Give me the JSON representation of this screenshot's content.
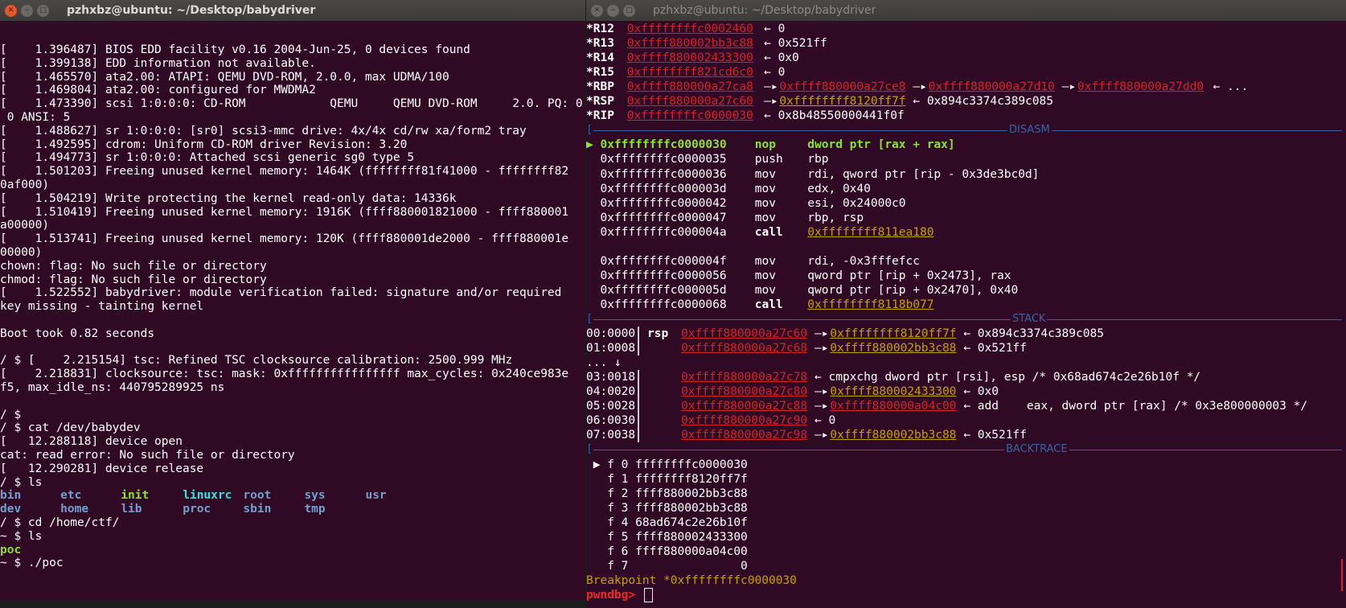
{
  "left": {
    "title": "pzhxbz@ubuntu: ~/Desktop/babydriver",
    "lines": [
      "[    1.396487] BIOS EDD facility v0.16 2004-Jun-25, 0 devices found",
      "[    1.399138] EDD information not available.",
      "[    1.465570] ata2.00: ATAPI: QEMU DVD-ROM, 2.0.0, max UDMA/100",
      "[    1.469804] ata2.00: configured for MWDMA2",
      "[    1.473390] scsi 1:0:0:0: CD-ROM            QEMU     QEMU DVD-ROM     2.0. PQ: 0",
      " 0 ANSI: 5",
      "[    1.488627] sr 1:0:0:0: [sr0] scsi3-mmc drive: 4x/4x cd/rw xa/form2 tray",
      "[    1.492595] cdrom: Uniform CD-ROM driver Revision: 3.20",
      "[    1.494773] sr 1:0:0:0: Attached scsi generic sg0 type 5",
      "[    1.501203] Freeing unused kernel memory: 1464K (ffffffff81f41000 - ffffffff82",
      "0af000)",
      "[    1.504219] Write protecting the kernel read-only data: 14336k",
      "[    1.510419] Freeing unused kernel memory: 1916K (ffff880001821000 - ffff880001",
      "a00000)",
      "[    1.513741] Freeing unused kernel memory: 120K (ffff880001de2000 - ffff880001e",
      "00000)",
      "chown: flag: No such file or directory",
      "chmod: flag: No such file or directory",
      "[    1.522552] babydriver: module verification failed: signature and/or required",
      "key missing - tainting kernel",
      "",
      "Boot took 0.82 seconds",
      "",
      "/ $ [    2.215154] tsc: Refined TSC clocksource calibration: 2500.999 MHz",
      "[    2.218831] clocksource: tsc: mask: 0xffffffffffffffff max_cycles: 0x240ce983e",
      "f5, max_idle_ns: 440795289925 ns",
      "",
      "/ $",
      "/ $ cat /dev/babydev",
      "[   12.288118] device open",
      "cat: read error: No such file or directory",
      "[   12.290281] device release",
      "/ $ ls"
    ],
    "ls1": [
      {
        "name": "bin",
        "c": "blu"
      },
      {
        "name": "etc",
        "c": "blu"
      },
      {
        "name": "init",
        "c": "grn"
      },
      {
        "name": "linuxrc",
        "c": "cyn"
      },
      {
        "name": "root",
        "c": "blu"
      },
      {
        "name": "sys",
        "c": "blu"
      },
      {
        "name": "usr",
        "c": "blu"
      }
    ],
    "ls2": [
      {
        "name": "dev",
        "c": "blu"
      },
      {
        "name": "home",
        "c": "blu"
      },
      {
        "name": "lib",
        "c": "blu"
      },
      {
        "name": "proc",
        "c": "blu"
      },
      {
        "name": "sbin",
        "c": "blu"
      },
      {
        "name": "tmp",
        "c": "blu"
      }
    ],
    "after": [
      "/ $ cd /home/ctf/",
      "~ $ ls"
    ],
    "poc": "poc",
    "last": "~ $ ./poc"
  },
  "right": {
    "title": "pzhxbz@ubuntu: ~/Desktop/babydriver",
    "regs": [
      {
        "n": "*R12",
        "v": "0xffffffffc0002460",
        "a": " ← 0"
      },
      {
        "n": "*R13",
        "v": "0xffff880002bb3c88",
        "a": " ← 0x521ff"
      },
      {
        "n": "*R14",
        "v": "0xffff880002433300",
        "a": " ← 0x0"
      },
      {
        "n": "*R15",
        "v": "0xffffffff821cd6c0",
        "a": " ← 0"
      },
      {
        "n": "*RSP",
        "v": "0xffff880000a27c60",
        "arrow": " —▸ ",
        "v2": "0xffffffff8120ff7f",
        "a": " ← 0x894c3374c389c085"
      },
      {
        "n": "*RIP",
        "v": "0xffffffffc0000030",
        "a": " ← 0x8b48550000441f0f"
      }
    ],
    "rbp": {
      "n": "*RBP",
      "v": "0xffff880000a27ca8",
      "c1": "0xffff880000a27ce8",
      "c2": "0xffff880000a27d10",
      "c3": "0xffff880000a27dd0",
      "tail": "← ..."
    },
    "disasm_label": "DISASM",
    "disasm": [
      {
        "addr": "▶ 0xffffffffc0000030",
        "op": "nop",
        "args": "dword ptr [rax + rax]",
        "cur": true
      },
      {
        "addr": "  0xffffffffc0000035",
        "op": "push",
        "args": "rbp"
      },
      {
        "addr": "  0xffffffffc0000036",
        "op": "mov",
        "args": "rdi, qword ptr [rip - 0x3de3bc0d]"
      },
      {
        "addr": "  0xffffffffc000003d",
        "op": "mov",
        "args": "edx, 0x40"
      },
      {
        "addr": "  0xffffffffc0000042",
        "op": "mov",
        "args": "esi, 0x24000c0"
      },
      {
        "addr": "  0xffffffffc0000047",
        "op": "mov",
        "args": "rbp, rsp"
      },
      {
        "addr": "  0xffffffffc000004a",
        "op": "call",
        "args": "0xffffffff811ea180",
        "link": true
      },
      {
        "addr": "",
        "op": "",
        "args": ""
      },
      {
        "addr": "  0xffffffffc000004f",
        "op": "mov",
        "args": "rdi, -0x3fffefcc"
      },
      {
        "addr": "  0xffffffffc0000056",
        "op": "mov",
        "args": "qword ptr [rip + 0x2473], rax"
      },
      {
        "addr": "  0xffffffffc000005d",
        "op": "mov",
        "args": "qword ptr [rip + 0x2470], 0x40"
      },
      {
        "addr": "  0xffffffffc0000068",
        "op": "call",
        "args": "0xffffffff8118b077",
        "link": true
      }
    ],
    "stack_label": "STACK",
    "stack": [
      {
        "off": "00:0000",
        "reg": "rsp",
        "a1": "0xffff880000a27c60",
        "a2": "0xffffffff8120ff7f",
        "a2c": "yel",
        "tail": " ← 0x894c3374c389c085"
      },
      {
        "off": "01:0008",
        "reg": "",
        "a1": "0xffff880000a27c68",
        "a2": "0xffff880002bb3c88",
        "a2c": "yel",
        "tail": " ← 0x521ff"
      },
      {
        "off": "... ↓",
        "dots": true
      },
      {
        "off": "03:0018",
        "reg": "",
        "a1": "0xffff880000a27c78",
        "a2": "",
        "tail": " ← cmpxchg dword ptr [rsi], esp /* 0x68ad674c2e26b10f */"
      },
      {
        "off": "04:0020",
        "reg": "",
        "a1": "0xffff880000a27c80",
        "a2": "0xffff880002433300",
        "a2c": "yel",
        "tail": " ← 0x0"
      },
      {
        "off": "05:0028",
        "reg": "",
        "a1": "0xffff880000a27c88",
        "a2": "0xffff880000a04c00",
        "a2c": "red",
        "tail": " ← add    eax, dword ptr [rax] /* 0x3e800000003 */"
      },
      {
        "off": "06:0030",
        "reg": "",
        "a1": "0xffff880000a27c90",
        "a2": "",
        "tail": " ← 0"
      },
      {
        "off": "07:0038",
        "reg": "",
        "a1": "0xffff880000a27c98",
        "a2": "0xffff880002bb3c88",
        "a2c": "yel",
        "tail": " ← 0x521ff"
      }
    ],
    "bt_label": "BACKTRACE",
    "bt": [
      " ▶ f 0 ffffffffc0000030",
      "   f 1 ffffffff8120ff7f",
      "   f 2 ffff880002bb3c88",
      "   f 3 ffff880002bb3c88",
      "   f 4 68ad674c2e26b10f",
      "   f 5 ffff880002433300",
      "   f 6 ffff880000a04c00",
      "   f 7                0"
    ],
    "bp": "Breakpoint *0xffffffffc0000030",
    "prompt": "pwndbg>"
  }
}
